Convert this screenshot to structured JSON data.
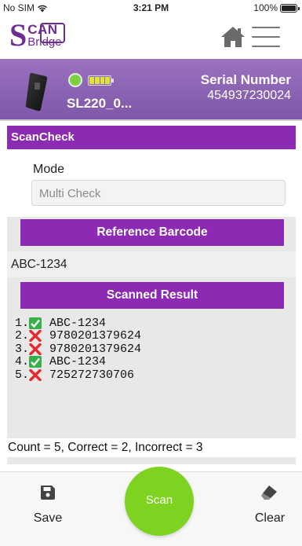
{
  "status_bar": {
    "carrier": "No SIM",
    "time": "3:21 PM",
    "battery": "100%"
  },
  "header": {
    "logo_s": "S",
    "logo_scan": "CAN",
    "logo_bridge": "Bridge"
  },
  "device": {
    "name": "SL220_0...",
    "serial_label": "Serial Number",
    "serial_value": "454937230024",
    "connection_color": "#7bd23e"
  },
  "scancheck": {
    "title": "ScanCheck",
    "mode_label": "Mode",
    "mode_value": "Multi Check",
    "reference_header": "Reference Barcode",
    "reference_value": "ABC-1234",
    "results_header": "Scanned Result",
    "results": [
      {
        "index": "1.",
        "status": "correct",
        "code": "ABC-1234"
      },
      {
        "index": "2.",
        "status": "incorrect",
        "code": "9780201379624"
      },
      {
        "index": "3.",
        "status": "incorrect",
        "code": "9780201379624"
      },
      {
        "index": "4.",
        "status": "correct",
        "code": "ABC-1234"
      },
      {
        "index": "5.",
        "status": "incorrect",
        "code": "725272730706"
      }
    ],
    "summary": "Count = 5, Correct = 2, Incorrect = 3"
  },
  "toolbar": {
    "save_label": "Save",
    "scan_label": "Scan",
    "clear_label": "Clear"
  },
  "colors": {
    "brand_purple": "#8c2ab3",
    "scan_green": "#7ed321",
    "correct_green": "#35b04a",
    "incorrect_red": "#e8282d"
  }
}
